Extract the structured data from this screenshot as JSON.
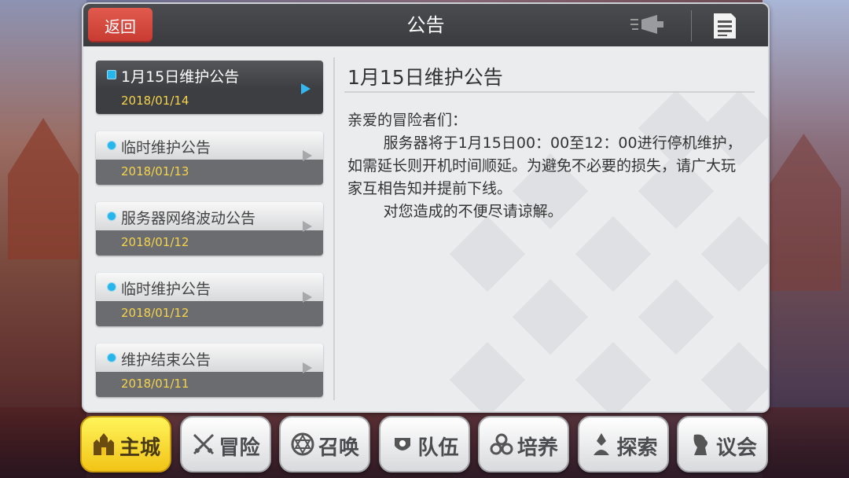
{
  "header": {
    "back_label": "返回",
    "title": "公告"
  },
  "announcements": [
    {
      "title": "1月15日维护公告",
      "date": "2018/01/14",
      "active": true
    },
    {
      "title": "临时维护公告",
      "date": "2018/01/13",
      "active": false
    },
    {
      "title": "服务器网络波动公告",
      "date": "2018/01/12",
      "active": false
    },
    {
      "title": "临时维护公告",
      "date": "2018/01/12",
      "active": false
    },
    {
      "title": "维护结束公告",
      "date": "2018/01/11",
      "active": false
    }
  ],
  "article": {
    "title": "1月15日维护公告",
    "greeting": "亲爱的冒险者们：",
    "paragraph1": "服务器将于1月15日00：00至12：00进行停机维护，如需延长则开机时间顺延。为避免不必要的损失，请广大玩家互相告知并提前下线。",
    "paragraph2": "对您造成的不便尽请谅解。"
  },
  "nav": [
    {
      "label": "主城",
      "icon": "castle-icon",
      "active": true
    },
    {
      "label": "冒险",
      "icon": "crossed-swords-icon",
      "active": false
    },
    {
      "label": "召唤",
      "icon": "summon-circle-icon",
      "active": false
    },
    {
      "label": "队伍",
      "icon": "team-icon",
      "active": false
    },
    {
      "label": "培养",
      "icon": "cultivate-icon",
      "active": false
    },
    {
      "label": "探索",
      "icon": "explore-icon",
      "active": false
    },
    {
      "label": "议会",
      "icon": "council-icon",
      "active": false
    }
  ],
  "colors": {
    "header_bg": "#3f4044",
    "back_button": "#d84a40",
    "accent_blue": "#27b6ea",
    "date_yellow": "#f5d44a",
    "nav_active": "#f7d52a"
  }
}
